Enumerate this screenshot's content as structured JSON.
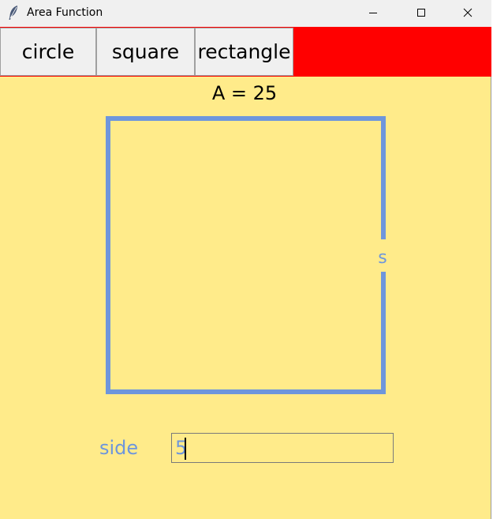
{
  "window": {
    "title": "Area Function",
    "icon": "feather-icon",
    "controls": [
      "minimize-icon",
      "maximize-icon",
      "close-icon"
    ]
  },
  "toolbar": {
    "buttons": [
      {
        "label": "circle"
      },
      {
        "label": "square"
      },
      {
        "label": "rectangle"
      }
    ],
    "accent_color": "#ff0000"
  },
  "canvas": {
    "area_text": "A = 25",
    "shape": "square",
    "side_marker": "s",
    "shape_color": "#6e96dc",
    "background_color": "#ffeb8a"
  },
  "form": {
    "side_label": "side",
    "side_value": "5"
  }
}
